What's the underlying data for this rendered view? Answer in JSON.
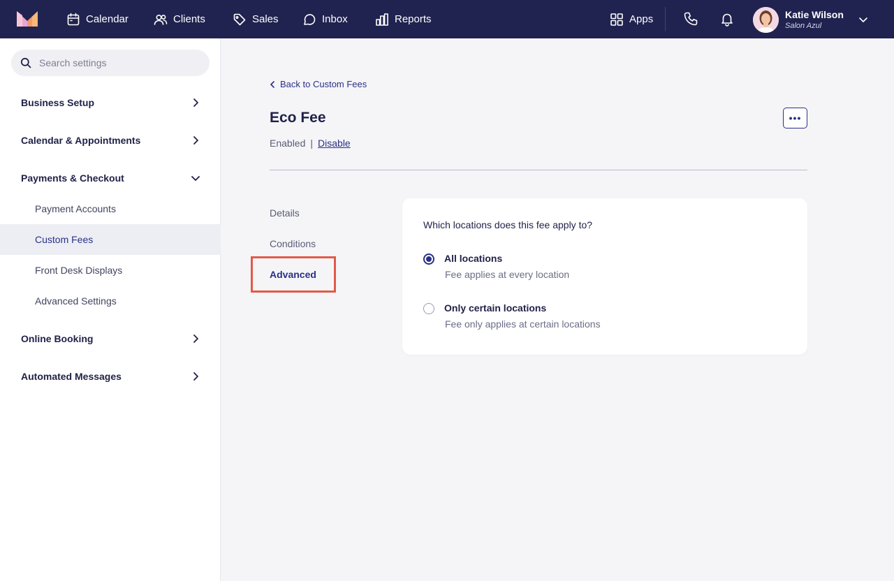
{
  "nav": {
    "items": [
      {
        "label": "Calendar",
        "icon": "calendar-icon"
      },
      {
        "label": "Clients",
        "icon": "users-icon"
      },
      {
        "label": "Sales",
        "icon": "tag-icon"
      },
      {
        "label": "Inbox",
        "icon": "chat-icon"
      },
      {
        "label": "Reports",
        "icon": "bar-chart-icon"
      }
    ],
    "apps_label": "Apps",
    "user_name": "Katie Wilson",
    "user_org": "Salon Azul"
  },
  "sidebar": {
    "search_placeholder": "Search settings",
    "sections": [
      {
        "label": "Business Setup",
        "expanded": false
      },
      {
        "label": "Calendar & Appointments",
        "expanded": false
      },
      {
        "label": "Payments & Checkout",
        "expanded": true
      },
      {
        "label": "Online Booking",
        "expanded": false
      },
      {
        "label": "Automated Messages",
        "expanded": false
      }
    ],
    "sub_items": [
      {
        "label": "Payment Accounts",
        "active": false
      },
      {
        "label": "Custom Fees",
        "active": true
      },
      {
        "label": "Front Desk Displays",
        "active": false
      },
      {
        "label": "Advanced Settings",
        "active": false
      }
    ]
  },
  "main": {
    "back_label": "Back to Custom Fees",
    "title": "Eco Fee",
    "status": "Enabled",
    "separator": "|",
    "disable_label": "Disable",
    "more_label": "•••",
    "tabs": [
      {
        "label": "Details",
        "active": false
      },
      {
        "label": "Conditions",
        "active": false
      },
      {
        "label": "Advanced",
        "active": true
      }
    ],
    "card": {
      "question": "Which locations does this fee apply to?",
      "options": [
        {
          "label": "All locations",
          "description": "Fee applies at every location",
          "selected": true
        },
        {
          "label": "Only certain locations",
          "description": "Fee only applies at certain locations",
          "selected": false
        }
      ]
    }
  },
  "colors": {
    "nav_bg": "#20234f",
    "accent": "#2a2f86",
    "highlight_border": "#e25a47",
    "page_bg": "#f5f5f8"
  }
}
